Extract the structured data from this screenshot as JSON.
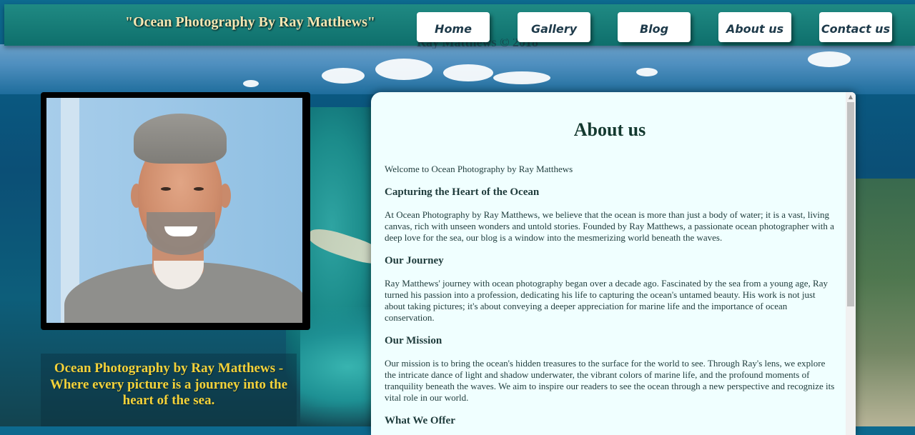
{
  "header": {
    "site_title": "\"Ocean Photography By Ray Matthews\"",
    "ghost_text": "Ray Matthews © 2018"
  },
  "nav": {
    "items": [
      {
        "label": "Home"
      },
      {
        "label": "Gallery"
      },
      {
        "label": "Blog"
      },
      {
        "label": "About us"
      },
      {
        "label": "Contact us"
      }
    ]
  },
  "sidebar": {
    "tagline": "Ocean Photography by Ray Matthews - Where every picture is a journey into the heart of the sea."
  },
  "main": {
    "title": "About us",
    "welcome": "Welcome to Ocean Photography by Ray Matthews",
    "sections": [
      {
        "heading": "Capturing the Heart of the Ocean",
        "body": "At Ocean Photography by Ray Matthews, we believe that the ocean is more than just a body of water; it is a vast, living canvas, rich with unseen wonders and untold stories. Founded by Ray Matthews, a passionate ocean photographer with a deep love for the sea, our blog is a window into the mesmerizing world beneath the waves."
      },
      {
        "heading": "Our Journey",
        "body": "Ray Matthews' journey with ocean photography began over a decade ago. Fascinated by the sea from a young age, Ray turned his passion into a profession, dedicating his life to capturing the ocean's untamed beauty. His work is not just about taking pictures; it's about conveying a deeper appreciation for marine life and the importance of ocean conservation."
      },
      {
        "heading": "Our Mission",
        "body": "Our mission is to bring the ocean's hidden treasures to the surface for the world to see. Through Ray's lens, we explore the intricate dance of light and shadow underwater, the vibrant colors of marine life, and the profound moments of tranquility beneath the waves. We aim to inspire our readers to see the ocean through a new perspective and recognize its vital role in our world."
      },
      {
        "heading": "What We Offer",
        "body": ""
      }
    ]
  },
  "scrollbar": {
    "up_arrow_icon": "chevron-up-icon"
  }
}
